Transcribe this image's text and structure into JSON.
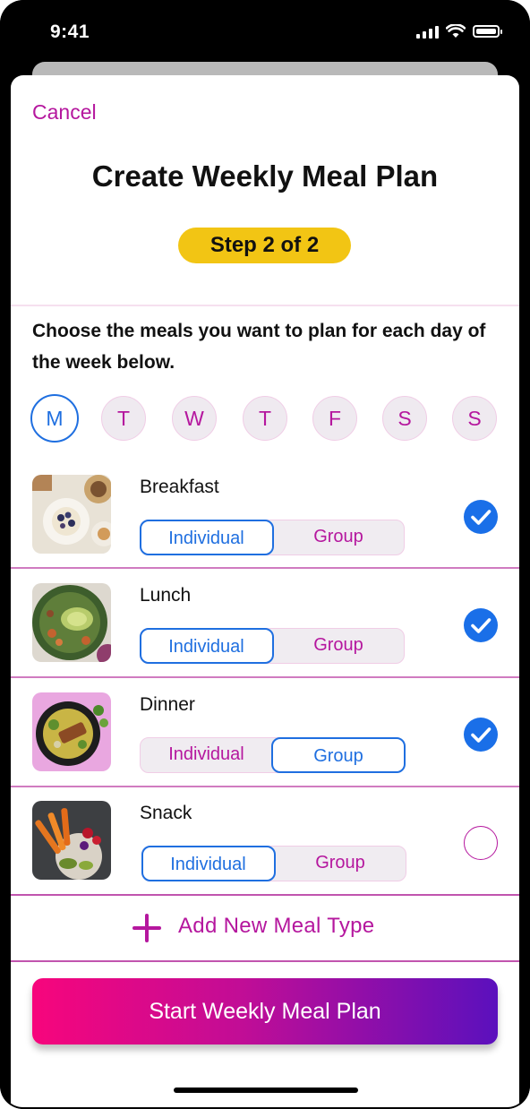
{
  "status_bar": {
    "time": "9:41"
  },
  "header": {
    "cancel_label": "Cancel",
    "title": "Create Weekly Meal Plan",
    "step": "Step 2 of 2"
  },
  "instructions": "Choose the meals you want to plan for each day of the week below.",
  "days": [
    {
      "label": "M",
      "selected": true
    },
    {
      "label": "T",
      "selected": false
    },
    {
      "label": "W",
      "selected": false
    },
    {
      "label": "T",
      "selected": false
    },
    {
      "label": "F",
      "selected": false
    },
    {
      "label": "S",
      "selected": false
    },
    {
      "label": "S",
      "selected": false
    }
  ],
  "meals": [
    {
      "name": "Breakfast",
      "options": [
        "Individual",
        "Group"
      ],
      "selected_option": "Individual",
      "checked": true
    },
    {
      "name": "Lunch",
      "options": [
        "Individual",
        "Group"
      ],
      "selected_option": "Individual",
      "checked": true
    },
    {
      "name": "Dinner",
      "options": [
        "Individual",
        "Group"
      ],
      "selected_option": "Group",
      "checked": true
    },
    {
      "name": "Snack",
      "options": [
        "Individual",
        "Group"
      ],
      "selected_option": "Individual",
      "checked": false
    }
  ],
  "add_meal_label": "Add New Meal Type",
  "cta_label": "Start Weekly Meal Plan",
  "colors": {
    "accent_magenta": "#b5179e",
    "accent_blue": "#1f6fe0",
    "step_badge": "#f2c514",
    "cta_gradient": [
      "#f7057c",
      "#c10d96",
      "#5b10bd"
    ]
  },
  "icons": {
    "signal": "cellular-signal-icon",
    "wifi": "wifi-icon",
    "battery": "battery-icon",
    "check": "checkmark-circle-icon",
    "plus": "plus-icon"
  }
}
